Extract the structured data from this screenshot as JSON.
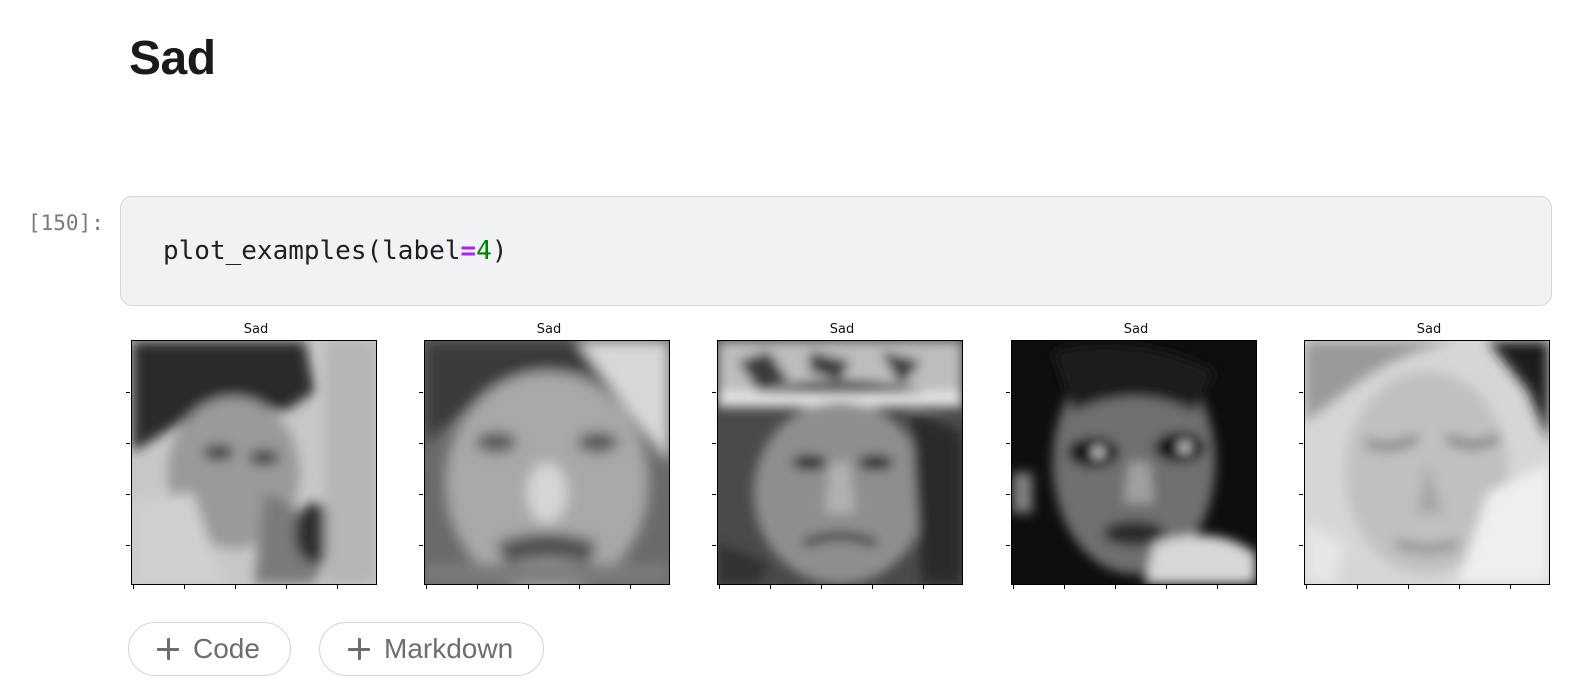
{
  "markdown": {
    "heading": "Sad"
  },
  "cell": {
    "prompt": "[150]:",
    "code": {
      "func": "plot_examples(label",
      "op": "=",
      "num": "4",
      "close": ")"
    }
  },
  "output": {
    "panels": [
      {
        "title": "Sad",
        "image": "grayscale-face-boy-hand-on-chin"
      },
      {
        "title": "Sad",
        "image": "grayscale-face-crying-child-closeup"
      },
      {
        "title": "Sad",
        "image": "grayscale-face-cyclist-helmet"
      },
      {
        "title": "Sad",
        "image": "grayscale-face-girl-dark-eyes"
      },
      {
        "title": "Sad",
        "image": "grayscale-face-woman-looking-down"
      }
    ]
  },
  "toolbar": {
    "add_code_label": "Code",
    "add_markdown_label": "Markdown",
    "icon": "plus-icon"
  }
}
